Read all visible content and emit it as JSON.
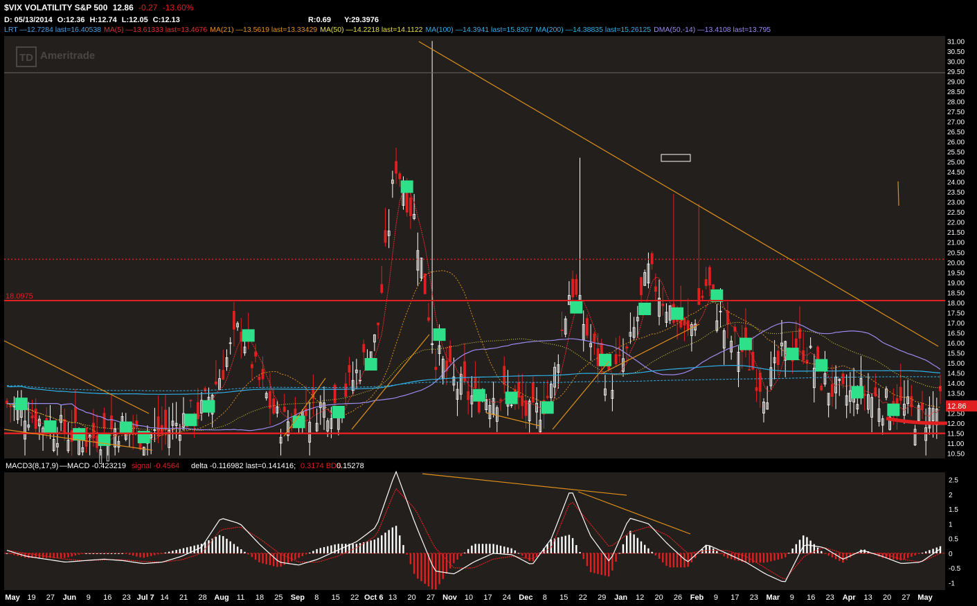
{
  "header": {
    "symbol": "$VIX VOLATILITY S&P 500",
    "last": "12.86",
    "change": "-0.27",
    "change_pct": "-13.60%",
    "date": "D: 05/13/2014",
    "open": "O:12.36",
    "high": "H:12.74",
    "low": "L:12.05",
    "close": "C:12.13",
    "r_value": "R:0.69",
    "y_value": "Y:29.3976",
    "studies": [
      {
        "label": "LRT",
        "text": "—12.7284 last=16.40538",
        "color": "#4aa3e8"
      },
      {
        "label": "MA(5)",
        "text": "—13.61333 last=13.4676",
        "color": "#e03030"
      },
      {
        "label": "MA(21)",
        "text": "—13.5619 last=13.33429",
        "color": "#e09020"
      },
      {
        "label": "MA(50)",
        "text": "—14.2218 last=14.1122",
        "color": "#e8e040"
      },
      {
        "label": "MA(100)",
        "text": "—14.3941 last=15.8267",
        "color": "#30b0e8"
      },
      {
        "label": "MA(200)",
        "text": "—14.38835 last=15.26125",
        "color": "#30b0e8"
      },
      {
        "label": "DMA(50,-14)",
        "text": "—13.4108 last=13.795",
        "color": "#9b8cf0"
      }
    ]
  },
  "logo": "Ameritrade",
  "logo_mark": "TD",
  "price_panel": {
    "level_label": "18.0975",
    "current_tag": "12.86",
    "y_ticks": [
      "31.00",
      "30.50",
      "30.00",
      "29.50",
      "29.00",
      "28.50",
      "28.00",
      "27.50",
      "27.00",
      "26.50",
      "26.00",
      "25.50",
      "25.00",
      "24.50",
      "24.00",
      "23.50",
      "23.00",
      "22.50",
      "22.00",
      "21.50",
      "21.00",
      "20.50",
      "20.00",
      "19.50",
      "19.00",
      "18.50",
      "18.00",
      "17.50",
      "17.00",
      "16.50",
      "16.00",
      "15.50",
      "15.00",
      "14.50",
      "14.00",
      "13.50",
      "13.00",
      "12.50",
      "12.00",
      "11.50",
      "11.00",
      "10.50"
    ]
  },
  "macd_panel": {
    "label": "MACD3(8,17,9)",
    "macd": "—MACD -0.423219",
    "signal": "signal -0.4564",
    "delta": "delta -0.116982 last=0.141416;",
    "extra": "0.3174 BDS",
    "extra2": "0.15278",
    "y_ticks": [
      "2.5",
      "2",
      "1.5",
      "1",
      "0.5",
      "0",
      "-0.5",
      "-1"
    ]
  },
  "x_ticks": [
    "May",
    "19",
    "27",
    "Jun",
    "9",
    "16",
    "23",
    "Jul 7",
    "14",
    "21",
    "28",
    "Aug",
    "11",
    "18",
    "25",
    "Sep",
    "8",
    "15",
    "22",
    "Oct 6",
    "13",
    "20",
    "27",
    "Nov",
    "10",
    "17",
    "24",
    "Dec",
    "8",
    "15",
    "22",
    "29",
    "Jan",
    "12",
    "20",
    "26",
    "Feb",
    "9",
    "17",
    "23",
    "Mar",
    "9",
    "16",
    "23",
    "Apr",
    "13",
    "20",
    "27",
    "May"
  ],
  "colors": {
    "up": "#ffffff",
    "down": "#e02020",
    "marker": "#2ee08a",
    "trend": "#e0901a",
    "level": "#e02020"
  },
  "chart_data": [
    {
      "type": "candlestick",
      "title": "$VIX VOLATILITY S&P 500",
      "ylim": [
        10.25,
        31.25
      ],
      "x": [
        "May",
        "19",
        "27",
        "Jun",
        "9",
        "16",
        "23",
        "Jul 7",
        "14",
        "21",
        "28",
        "Aug",
        "11",
        "18",
        "25",
        "Sep",
        "8",
        "15",
        "22",
        "Oct 6",
        "13",
        "20",
        "27",
        "Nov",
        "10",
        "17",
        "24",
        "Dec",
        "8",
        "15",
        "22",
        "29",
        "Jan",
        "12",
        "20",
        "26",
        "Feb",
        "9",
        "17",
        "23",
        "Mar",
        "9",
        "16",
        "23",
        "Apr",
        "13",
        "20",
        "27",
        "May"
      ],
      "series": [
        {
          "name": "Close",
          "values": [
            13.0,
            12.6,
            11.9,
            11.6,
            11.2,
            11.5,
            11.9,
            11.3,
            11.5,
            12.2,
            12.6,
            14.5,
            16.8,
            14.0,
            12.0,
            12.3,
            12.8,
            13.0,
            14.5,
            16.2,
            25.0,
            22.0,
            15.5,
            14.0,
            13.2,
            13.5,
            13.3,
            12.2,
            13.6,
            19.0,
            16.0,
            14.0,
            15.6,
            19.5,
            17.8,
            16.3,
            19.0,
            16.4,
            15.4,
            13.6,
            15.5,
            15.8,
            14.0,
            13.3,
            13.6,
            13.0,
            12.8,
            12.2,
            12.86
          ]
        }
      ],
      "levels": [
        18.0975,
        20.15,
        11.5
      ],
      "level_labels": [
        "18.0975"
      ],
      "grid": false
    },
    {
      "type": "line",
      "title": "MACD3(8,17,9)",
      "ylim": [
        -1.25,
        2.75
      ],
      "x": [
        "May",
        "19",
        "27",
        "Jun",
        "9",
        "16",
        "23",
        "Jul 7",
        "14",
        "21",
        "28",
        "Aug",
        "11",
        "18",
        "25",
        "Sep",
        "8",
        "15",
        "22",
        "Oct 6",
        "13",
        "20",
        "27",
        "Nov",
        "10",
        "17",
        "24",
        "Dec",
        "8",
        "15",
        "22",
        "29",
        "Jan",
        "12",
        "20",
        "26",
        "Feb",
        "9",
        "17",
        "23",
        "Mar",
        "9",
        "16",
        "23",
        "Apr",
        "13",
        "20",
        "27",
        "May"
      ],
      "series": [
        {
          "name": "MACD",
          "values": [
            0.1,
            -0.1,
            -0.2,
            -0.3,
            -0.25,
            -0.2,
            -0.25,
            -0.35,
            -0.3,
            -0.1,
            0.2,
            1.2,
            1.0,
            0.3,
            -0.3,
            -0.4,
            -0.2,
            0.1,
            0.4,
            0.9,
            2.8,
            1.0,
            -0.6,
            -0.7,
            -0.3,
            0.0,
            -0.05,
            -0.4,
            0.5,
            2.2,
            0.6,
            -0.3,
            1.2,
            1.0,
            0.3,
            -0.3,
            0.3,
            0.0,
            -0.3,
            -0.7,
            -1.0,
            0.3,
            0.2,
            -0.2,
            0.1,
            -0.1,
            -0.35,
            -0.3,
            0.15
          ]
        },
        {
          "name": "signal",
          "values": [
            0.1,
            0.0,
            -0.1,
            -0.2,
            -0.25,
            -0.22,
            -0.22,
            -0.28,
            -0.3,
            -0.22,
            0.0,
            0.8,
            0.9,
            0.5,
            0.0,
            -0.3,
            -0.3,
            -0.1,
            0.2,
            0.6,
            2.2,
            1.5,
            0.2,
            -0.5,
            -0.5,
            -0.2,
            -0.1,
            -0.2,
            0.2,
            1.8,
            1.0,
            0.2,
            0.7,
            0.9,
            0.6,
            0.0,
            0.1,
            0.1,
            -0.1,
            -0.5,
            -0.9,
            -0.1,
            0.2,
            0.0,
            0.0,
            0.0,
            -0.2,
            -0.3,
            0.0
          ]
        }
      ],
      "histogram": [
        0.0,
        -0.1,
        -0.1,
        -0.1,
        0.0,
        0.0,
        0.0,
        -0.1,
        0.0,
        0.1,
        0.2,
        0.4,
        0.1,
        -0.2,
        -0.3,
        -0.1,
        0.1,
        0.2,
        0.2,
        0.3,
        0.6,
        -0.5,
        -0.8,
        -0.2,
        0.2,
        0.2,
        0.1,
        -0.2,
        0.3,
        0.4,
        -0.4,
        -0.5,
        0.5,
        0.1,
        -0.3,
        -0.3,
        0.2,
        -0.1,
        -0.2,
        -0.2,
        -0.1,
        0.4,
        0.0,
        -0.2,
        0.1,
        -0.1,
        -0.15,
        0.0,
        0.15
      ],
      "grid": false
    }
  ]
}
